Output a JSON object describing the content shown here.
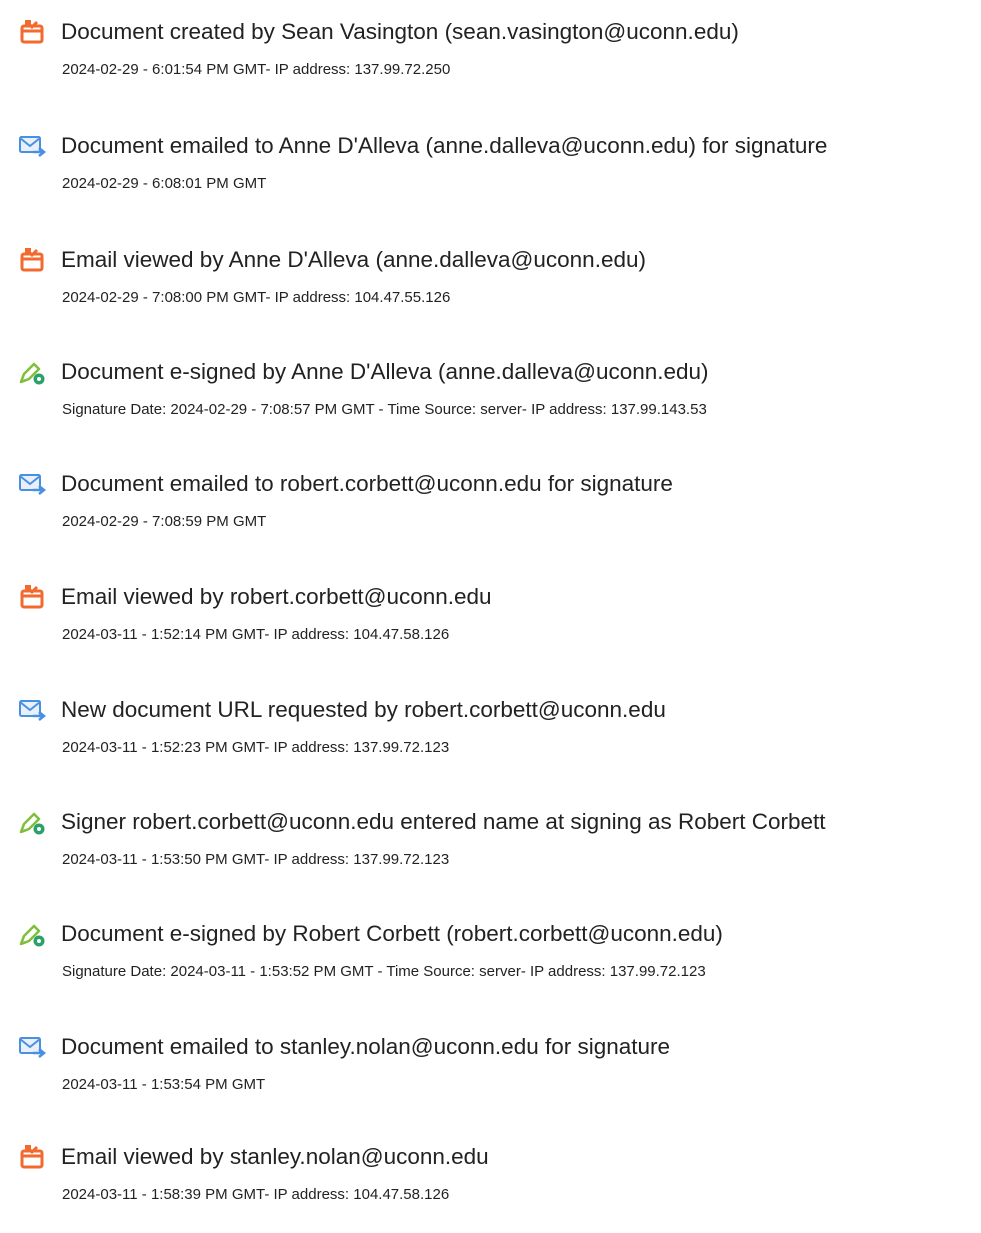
{
  "colors": {
    "document_icon": "#f26a2e",
    "email_icon": "#4a90e2",
    "signature_icon_pen": "#7fbf3a",
    "signature_icon_badge": "#2aa06b",
    "text": "#222222"
  },
  "events": [
    {
      "icon": "document-icon",
      "title": "Document created by Sean Vasington (sean.vasington@uconn.edu)",
      "detail": "2024-02-29 - 6:01:54 PM GMT- IP address: 137.99.72.250"
    },
    {
      "icon": "email-icon",
      "title": "Document emailed to Anne D'Alleva (anne.dalleva@uconn.edu) for signature",
      "detail": "2024-02-29 - 6:08:01 PM GMT"
    },
    {
      "icon": "document-icon",
      "title": "Email viewed by Anne D'Alleva (anne.dalleva@uconn.edu)",
      "detail": "2024-02-29 - 7:08:00 PM GMT- IP address: 104.47.55.126"
    },
    {
      "icon": "signature-icon",
      "title": "Document e-signed by Anne D'Alleva (anne.dalleva@uconn.edu)",
      "detail": "Signature Date: 2024-02-29 - 7:08:57 PM GMT - Time Source: server- IP address: 137.99.143.53"
    },
    {
      "icon": "email-icon",
      "title": "Document emailed to robert.corbett@uconn.edu for signature",
      "detail": "2024-02-29 - 7:08:59 PM GMT"
    },
    {
      "icon": "document-icon",
      "title": "Email viewed by robert.corbett@uconn.edu",
      "detail": "2024-03-11 - 1:52:14 PM GMT- IP address: 104.47.58.126"
    },
    {
      "icon": "email-icon",
      "title": "New document URL requested by robert.corbett@uconn.edu",
      "detail": "2024-03-11 - 1:52:23 PM GMT- IP address: 137.99.72.123"
    },
    {
      "icon": "signature-icon",
      "title": "Signer robert.corbett@uconn.edu entered name at signing as Robert Corbett",
      "detail": "2024-03-11 - 1:53:50 PM GMT- IP address: 137.99.72.123"
    },
    {
      "icon": "signature-icon",
      "title": "Document e-signed by Robert Corbett (robert.corbett@uconn.edu)",
      "detail": "Signature Date: 2024-03-11 - 1:53:52 PM GMT - Time Source: server- IP address: 137.99.72.123"
    },
    {
      "icon": "email-icon",
      "title": "Document emailed to stanley.nolan@uconn.edu for signature",
      "detail": "2024-03-11 - 1:53:54 PM GMT"
    },
    {
      "icon": "document-icon",
      "title": "Email viewed by stanley.nolan@uconn.edu",
      "detail": "2024-03-11 - 1:58:39 PM GMT- IP address: 104.47.58.126"
    }
  ]
}
